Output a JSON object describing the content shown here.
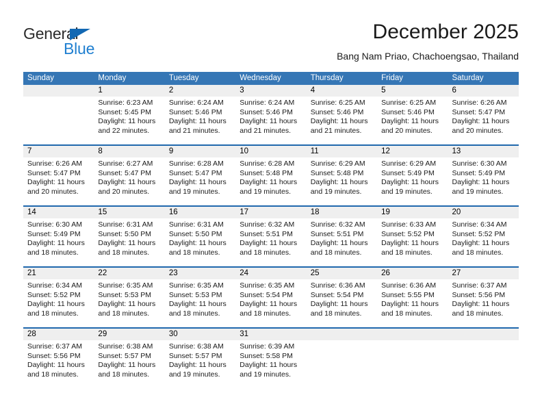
{
  "logo": {
    "word1": "General",
    "word2": "Blue",
    "triangle_color": "#1268b3",
    "word1_color": "#2b2b2b",
    "word2_color": "#1f7fd0"
  },
  "header": {
    "title": "December 2025",
    "subtitle": "Bang Nam Priao, Chachoengsao, Thailand"
  },
  "colors": {
    "header_blue": "#3576b5",
    "row_rule_blue": "#1f68ad",
    "daynum_band": "#efefef"
  },
  "weekdays": [
    "Sunday",
    "Monday",
    "Tuesday",
    "Wednesday",
    "Thursday",
    "Friday",
    "Saturday"
  ],
  "weeks": [
    {
      "days": [
        {
          "num": "",
          "sunrise": "",
          "sunset": "",
          "daylight1": "",
          "daylight2": ""
        },
        {
          "num": "1",
          "sunrise": "Sunrise: 6:23 AM",
          "sunset": "Sunset: 5:45 PM",
          "daylight1": "Daylight: 11 hours",
          "daylight2": "and 22 minutes."
        },
        {
          "num": "2",
          "sunrise": "Sunrise: 6:24 AM",
          "sunset": "Sunset: 5:46 PM",
          "daylight1": "Daylight: 11 hours",
          "daylight2": "and 21 minutes."
        },
        {
          "num": "3",
          "sunrise": "Sunrise: 6:24 AM",
          "sunset": "Sunset: 5:46 PM",
          "daylight1": "Daylight: 11 hours",
          "daylight2": "and 21 minutes."
        },
        {
          "num": "4",
          "sunrise": "Sunrise: 6:25 AM",
          "sunset": "Sunset: 5:46 PM",
          "daylight1": "Daylight: 11 hours",
          "daylight2": "and 21 minutes."
        },
        {
          "num": "5",
          "sunrise": "Sunrise: 6:25 AM",
          "sunset": "Sunset: 5:46 PM",
          "daylight1": "Daylight: 11 hours",
          "daylight2": "and 20 minutes."
        },
        {
          "num": "6",
          "sunrise": "Sunrise: 6:26 AM",
          "sunset": "Sunset: 5:47 PM",
          "daylight1": "Daylight: 11 hours",
          "daylight2": "and 20 minutes."
        }
      ]
    },
    {
      "days": [
        {
          "num": "7",
          "sunrise": "Sunrise: 6:26 AM",
          "sunset": "Sunset: 5:47 PM",
          "daylight1": "Daylight: 11 hours",
          "daylight2": "and 20 minutes."
        },
        {
          "num": "8",
          "sunrise": "Sunrise: 6:27 AM",
          "sunset": "Sunset: 5:47 PM",
          "daylight1": "Daylight: 11 hours",
          "daylight2": "and 20 minutes."
        },
        {
          "num": "9",
          "sunrise": "Sunrise: 6:28 AM",
          "sunset": "Sunset: 5:47 PM",
          "daylight1": "Daylight: 11 hours",
          "daylight2": "and 19 minutes."
        },
        {
          "num": "10",
          "sunrise": "Sunrise: 6:28 AM",
          "sunset": "Sunset: 5:48 PM",
          "daylight1": "Daylight: 11 hours",
          "daylight2": "and 19 minutes."
        },
        {
          "num": "11",
          "sunrise": "Sunrise: 6:29 AM",
          "sunset": "Sunset: 5:48 PM",
          "daylight1": "Daylight: 11 hours",
          "daylight2": "and 19 minutes."
        },
        {
          "num": "12",
          "sunrise": "Sunrise: 6:29 AM",
          "sunset": "Sunset: 5:49 PM",
          "daylight1": "Daylight: 11 hours",
          "daylight2": "and 19 minutes."
        },
        {
          "num": "13",
          "sunrise": "Sunrise: 6:30 AM",
          "sunset": "Sunset: 5:49 PM",
          "daylight1": "Daylight: 11 hours",
          "daylight2": "and 19 minutes."
        }
      ]
    },
    {
      "days": [
        {
          "num": "14",
          "sunrise": "Sunrise: 6:30 AM",
          "sunset": "Sunset: 5:49 PM",
          "daylight1": "Daylight: 11 hours",
          "daylight2": "and 18 minutes."
        },
        {
          "num": "15",
          "sunrise": "Sunrise: 6:31 AM",
          "sunset": "Sunset: 5:50 PM",
          "daylight1": "Daylight: 11 hours",
          "daylight2": "and 18 minutes."
        },
        {
          "num": "16",
          "sunrise": "Sunrise: 6:31 AM",
          "sunset": "Sunset: 5:50 PM",
          "daylight1": "Daylight: 11 hours",
          "daylight2": "and 18 minutes."
        },
        {
          "num": "17",
          "sunrise": "Sunrise: 6:32 AM",
          "sunset": "Sunset: 5:51 PM",
          "daylight1": "Daylight: 11 hours",
          "daylight2": "and 18 minutes."
        },
        {
          "num": "18",
          "sunrise": "Sunrise: 6:32 AM",
          "sunset": "Sunset: 5:51 PM",
          "daylight1": "Daylight: 11 hours",
          "daylight2": "and 18 minutes."
        },
        {
          "num": "19",
          "sunrise": "Sunrise: 6:33 AM",
          "sunset": "Sunset: 5:52 PM",
          "daylight1": "Daylight: 11 hours",
          "daylight2": "and 18 minutes."
        },
        {
          "num": "20",
          "sunrise": "Sunrise: 6:34 AM",
          "sunset": "Sunset: 5:52 PM",
          "daylight1": "Daylight: 11 hours",
          "daylight2": "and 18 minutes."
        }
      ]
    },
    {
      "days": [
        {
          "num": "21",
          "sunrise": "Sunrise: 6:34 AM",
          "sunset": "Sunset: 5:52 PM",
          "daylight1": "Daylight: 11 hours",
          "daylight2": "and 18 minutes."
        },
        {
          "num": "22",
          "sunrise": "Sunrise: 6:35 AM",
          "sunset": "Sunset: 5:53 PM",
          "daylight1": "Daylight: 11 hours",
          "daylight2": "and 18 minutes."
        },
        {
          "num": "23",
          "sunrise": "Sunrise: 6:35 AM",
          "sunset": "Sunset: 5:53 PM",
          "daylight1": "Daylight: 11 hours",
          "daylight2": "and 18 minutes."
        },
        {
          "num": "24",
          "sunrise": "Sunrise: 6:35 AM",
          "sunset": "Sunset: 5:54 PM",
          "daylight1": "Daylight: 11 hours",
          "daylight2": "and 18 minutes."
        },
        {
          "num": "25",
          "sunrise": "Sunrise: 6:36 AM",
          "sunset": "Sunset: 5:54 PM",
          "daylight1": "Daylight: 11 hours",
          "daylight2": "and 18 minutes."
        },
        {
          "num": "26",
          "sunrise": "Sunrise: 6:36 AM",
          "sunset": "Sunset: 5:55 PM",
          "daylight1": "Daylight: 11 hours",
          "daylight2": "and 18 minutes."
        },
        {
          "num": "27",
          "sunrise": "Sunrise: 6:37 AM",
          "sunset": "Sunset: 5:56 PM",
          "daylight1": "Daylight: 11 hours",
          "daylight2": "and 18 minutes."
        }
      ]
    },
    {
      "days": [
        {
          "num": "28",
          "sunrise": "Sunrise: 6:37 AM",
          "sunset": "Sunset: 5:56 PM",
          "daylight1": "Daylight: 11 hours",
          "daylight2": "and 18 minutes."
        },
        {
          "num": "29",
          "sunrise": "Sunrise: 6:38 AM",
          "sunset": "Sunset: 5:57 PM",
          "daylight1": "Daylight: 11 hours",
          "daylight2": "and 18 minutes."
        },
        {
          "num": "30",
          "sunrise": "Sunrise: 6:38 AM",
          "sunset": "Sunset: 5:57 PM",
          "daylight1": "Daylight: 11 hours",
          "daylight2": "and 19 minutes."
        },
        {
          "num": "31",
          "sunrise": "Sunrise: 6:39 AM",
          "sunset": "Sunset: 5:58 PM",
          "daylight1": "Daylight: 11 hours",
          "daylight2": "and 19 minutes."
        },
        {
          "num": "",
          "sunrise": "",
          "sunset": "",
          "daylight1": "",
          "daylight2": ""
        },
        {
          "num": "",
          "sunrise": "",
          "sunset": "",
          "daylight1": "",
          "daylight2": ""
        },
        {
          "num": "",
          "sunrise": "",
          "sunset": "",
          "daylight1": "",
          "daylight2": ""
        }
      ]
    }
  ]
}
